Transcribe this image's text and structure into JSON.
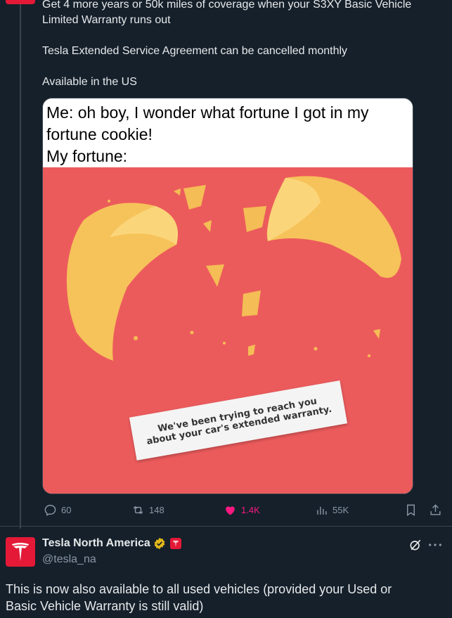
{
  "tweet": {
    "paragraphs": [
      "Get 4 more years or 50k miles of coverage when your S3XY Basic Vehicle\nLimited Warranty runs out",
      "Tesla Extended Service Agreement can be cancelled monthly",
      "Available in the US"
    ],
    "media": {
      "caption_line1": "Me: oh boy, I wonder what fortune I got in my\nfortune cookie!",
      "caption_line2": "My fortune:",
      "fortune_text": "We've been trying to reach you\nabout your car's extended warranty."
    },
    "actions": {
      "replies": "60",
      "reposts": "148",
      "likes": "1.4K",
      "views": "55K"
    }
  },
  "reply": {
    "author_name": "Tesla North America",
    "handle": "@tesla_na",
    "text": "This is now also available to all used vehicles (provided your Used or\nBasic Vehicle Warranty is still valid)"
  },
  "colors": {
    "background": "#15202b",
    "tesla_red": "#e31937",
    "like_pink": "#f91880",
    "muted": "#8b98a5",
    "verified_gold": "#e2b719"
  }
}
